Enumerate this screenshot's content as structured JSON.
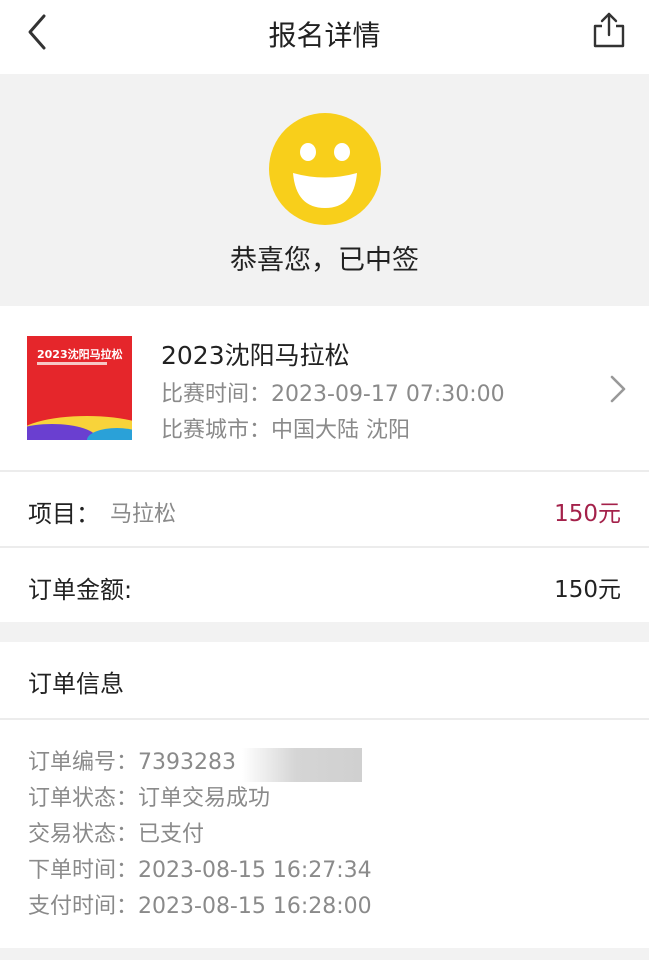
{
  "nav": {
    "title": "报名详情",
    "back_icon": "chevron-left-icon",
    "share_icon": "share-icon"
  },
  "hero": {
    "message": "恭喜您，已中签",
    "icon": "smiley-icon",
    "icon_color": "#f8cf1b"
  },
  "event": {
    "name": "2023沈阳马拉松",
    "time_label": "比赛时间：",
    "time_value": "2023-09-17 07:30:00",
    "city_label": "比赛城市：",
    "city_value": "中国大陆 沈阳",
    "poster_title": "2023沈阳马拉松"
  },
  "project": {
    "label": "项目：",
    "value": "马拉松",
    "price": "150元",
    "price_color": "#a4214a"
  },
  "order_amount": {
    "label": "订单金额:",
    "value": "150元"
  },
  "order_info": {
    "heading": "订单信息",
    "rows": [
      {
        "label": "订单编号：",
        "value": "7393283"
      },
      {
        "label": "订单状态：",
        "value": "订单交易成功"
      },
      {
        "label": "交易状态：",
        "value": "已支付"
      },
      {
        "label": "下单时间：",
        "value": "2023-08-15 16:27:34"
      },
      {
        "label": "支付时间：",
        "value": "2023-08-15 16:28:00"
      }
    ]
  }
}
